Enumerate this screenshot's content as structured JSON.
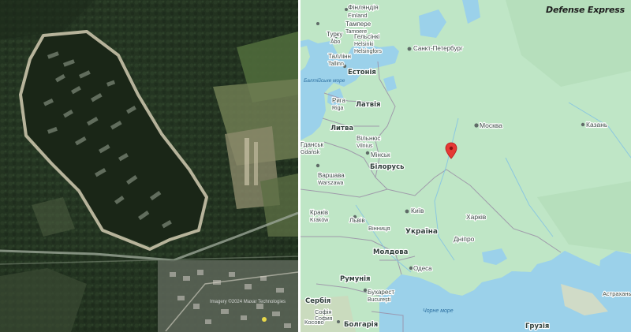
{
  "brand": "Defense Express",
  "satellite": {
    "credit": "Imagery ©2024 Maxar Technologies"
  },
  "map": {
    "marker_color": "#e53935",
    "land_color": "#bfe6c6",
    "water_color": "#9bd1ea",
    "countries": [
      {
        "id": "finland",
        "text": "Фінляндія"
      },
      {
        "id": "finland-lat",
        "text": "Finland"
      },
      {
        "id": "estonia",
        "text": "Естонія"
      },
      {
        "id": "latvia",
        "text": "Латвія"
      },
      {
        "id": "lithuania",
        "text": "Литва"
      },
      {
        "id": "belarus",
        "text": "Білорусь"
      },
      {
        "id": "ukraine",
        "text": "Україна"
      },
      {
        "id": "moldova",
        "text": "Молдова"
      },
      {
        "id": "romania",
        "text": "Румунія"
      },
      {
        "id": "serbia",
        "text": "Сербія"
      },
      {
        "id": "bulgaria",
        "text": "Болгарія"
      },
      {
        "id": "georgia",
        "text": "Грузія"
      }
    ],
    "cities": [
      {
        "id": "tampere",
        "text": "Тампере"
      },
      {
        "id": "tampere-lat",
        "text": "Tampere"
      },
      {
        "id": "turku",
        "text": "Турку"
      },
      {
        "id": "abo",
        "text": "Åbo"
      },
      {
        "id": "helsinki",
        "text": "Гельсінкі"
      },
      {
        "id": "helsinki-sv",
        "text": "Helsinki"
      },
      {
        "id": "helsingfors",
        "text": "Helsingfors"
      },
      {
        "id": "tallinn",
        "text": "Таллінн"
      },
      {
        "id": "tallinn-lat",
        "text": "Tallinn"
      },
      {
        "id": "spb",
        "text": "Санкт-Петербург"
      },
      {
        "id": "riga",
        "text": "Рига"
      },
      {
        "id": "riga-lat",
        "text": "Riga"
      },
      {
        "id": "moscow",
        "text": "Москва"
      },
      {
        "id": "kazan",
        "text": "Казань"
      },
      {
        "id": "vilnius",
        "text": "Вільнюс"
      },
      {
        "id": "vilnius-lat",
        "text": "Vilnius"
      },
      {
        "id": "minsk",
        "text": "Мінськ"
      },
      {
        "id": "gdansk",
        "text": "Гданськ"
      },
      {
        "id": "gdansk-lat",
        "text": "Gdańsk"
      },
      {
        "id": "warsaw",
        "text": "Варшава"
      },
      {
        "id": "warsaw-lat",
        "text": "Warszawa"
      },
      {
        "id": "krakow",
        "text": "Краків"
      },
      {
        "id": "krakow-lat",
        "text": "Kraków"
      },
      {
        "id": "lviv",
        "text": "Львів"
      },
      {
        "id": "kyiv",
        "text": "Київ"
      },
      {
        "id": "kharkiv",
        "text": "Харків"
      },
      {
        "id": "vinnytsia",
        "text": "Вінниця"
      },
      {
        "id": "dnipro",
        "text": "Дніпро"
      },
      {
        "id": "odesa",
        "text": "Одеса"
      },
      {
        "id": "bucharest",
        "text": "Бухарест"
      },
      {
        "id": "bucharest-lat",
        "text": "București"
      },
      {
        "id": "sofia",
        "text": "Софія"
      },
      {
        "id": "sofia-lat",
        "text": "София"
      },
      {
        "id": "kosovo",
        "text": "Косово"
      },
      {
        "id": "astrakhan",
        "text": "Астрахань"
      }
    ],
    "seas": [
      {
        "id": "baltic",
        "text": "Балтійське море"
      },
      {
        "id": "black",
        "text": "Чорне море"
      }
    ]
  }
}
